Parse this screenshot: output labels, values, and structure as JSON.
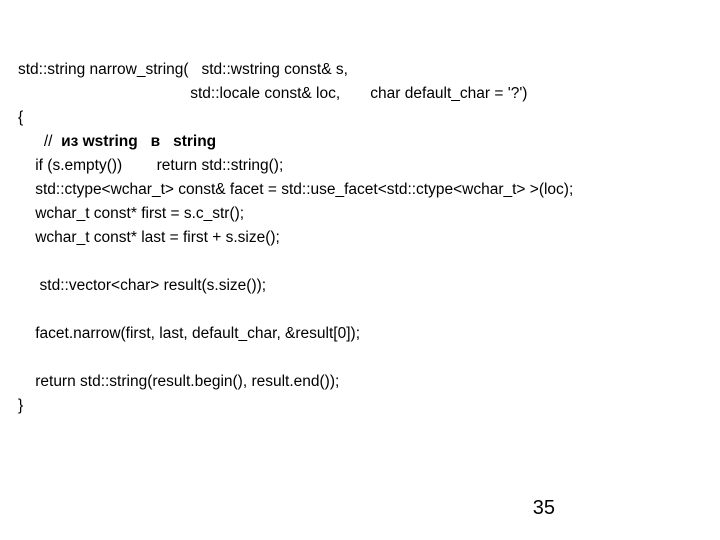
{
  "code": {
    "l1": "std::string narrow_string(   std::wstring const& s,",
    "l2": "                                        std::locale const& loc,       char default_char = '?')",
    "l3": "{",
    "l4a": "      //  ",
    "l4b": "из wstring   в   string",
    "l5": "    if (s.empty())        return std::string();",
    "l6": "    std::ctype<wchar_t> const& facet = std::use_facet<std::ctype<wchar_t> >(loc);",
    "l7": "    wchar_t const* first = s.c_str();",
    "l8": "    wchar_t const* last = first + s.size();",
    "blank1": " ",
    "l9": "     std::vector<char> result(s.size());",
    "blank2": " ",
    "l10": "    facet.narrow(first, last, default_char, &result[0]);",
    "blank3": " ",
    "l11": "    return std::string(result.begin(), result.end());",
    "l12": "}"
  },
  "page_number": "35"
}
